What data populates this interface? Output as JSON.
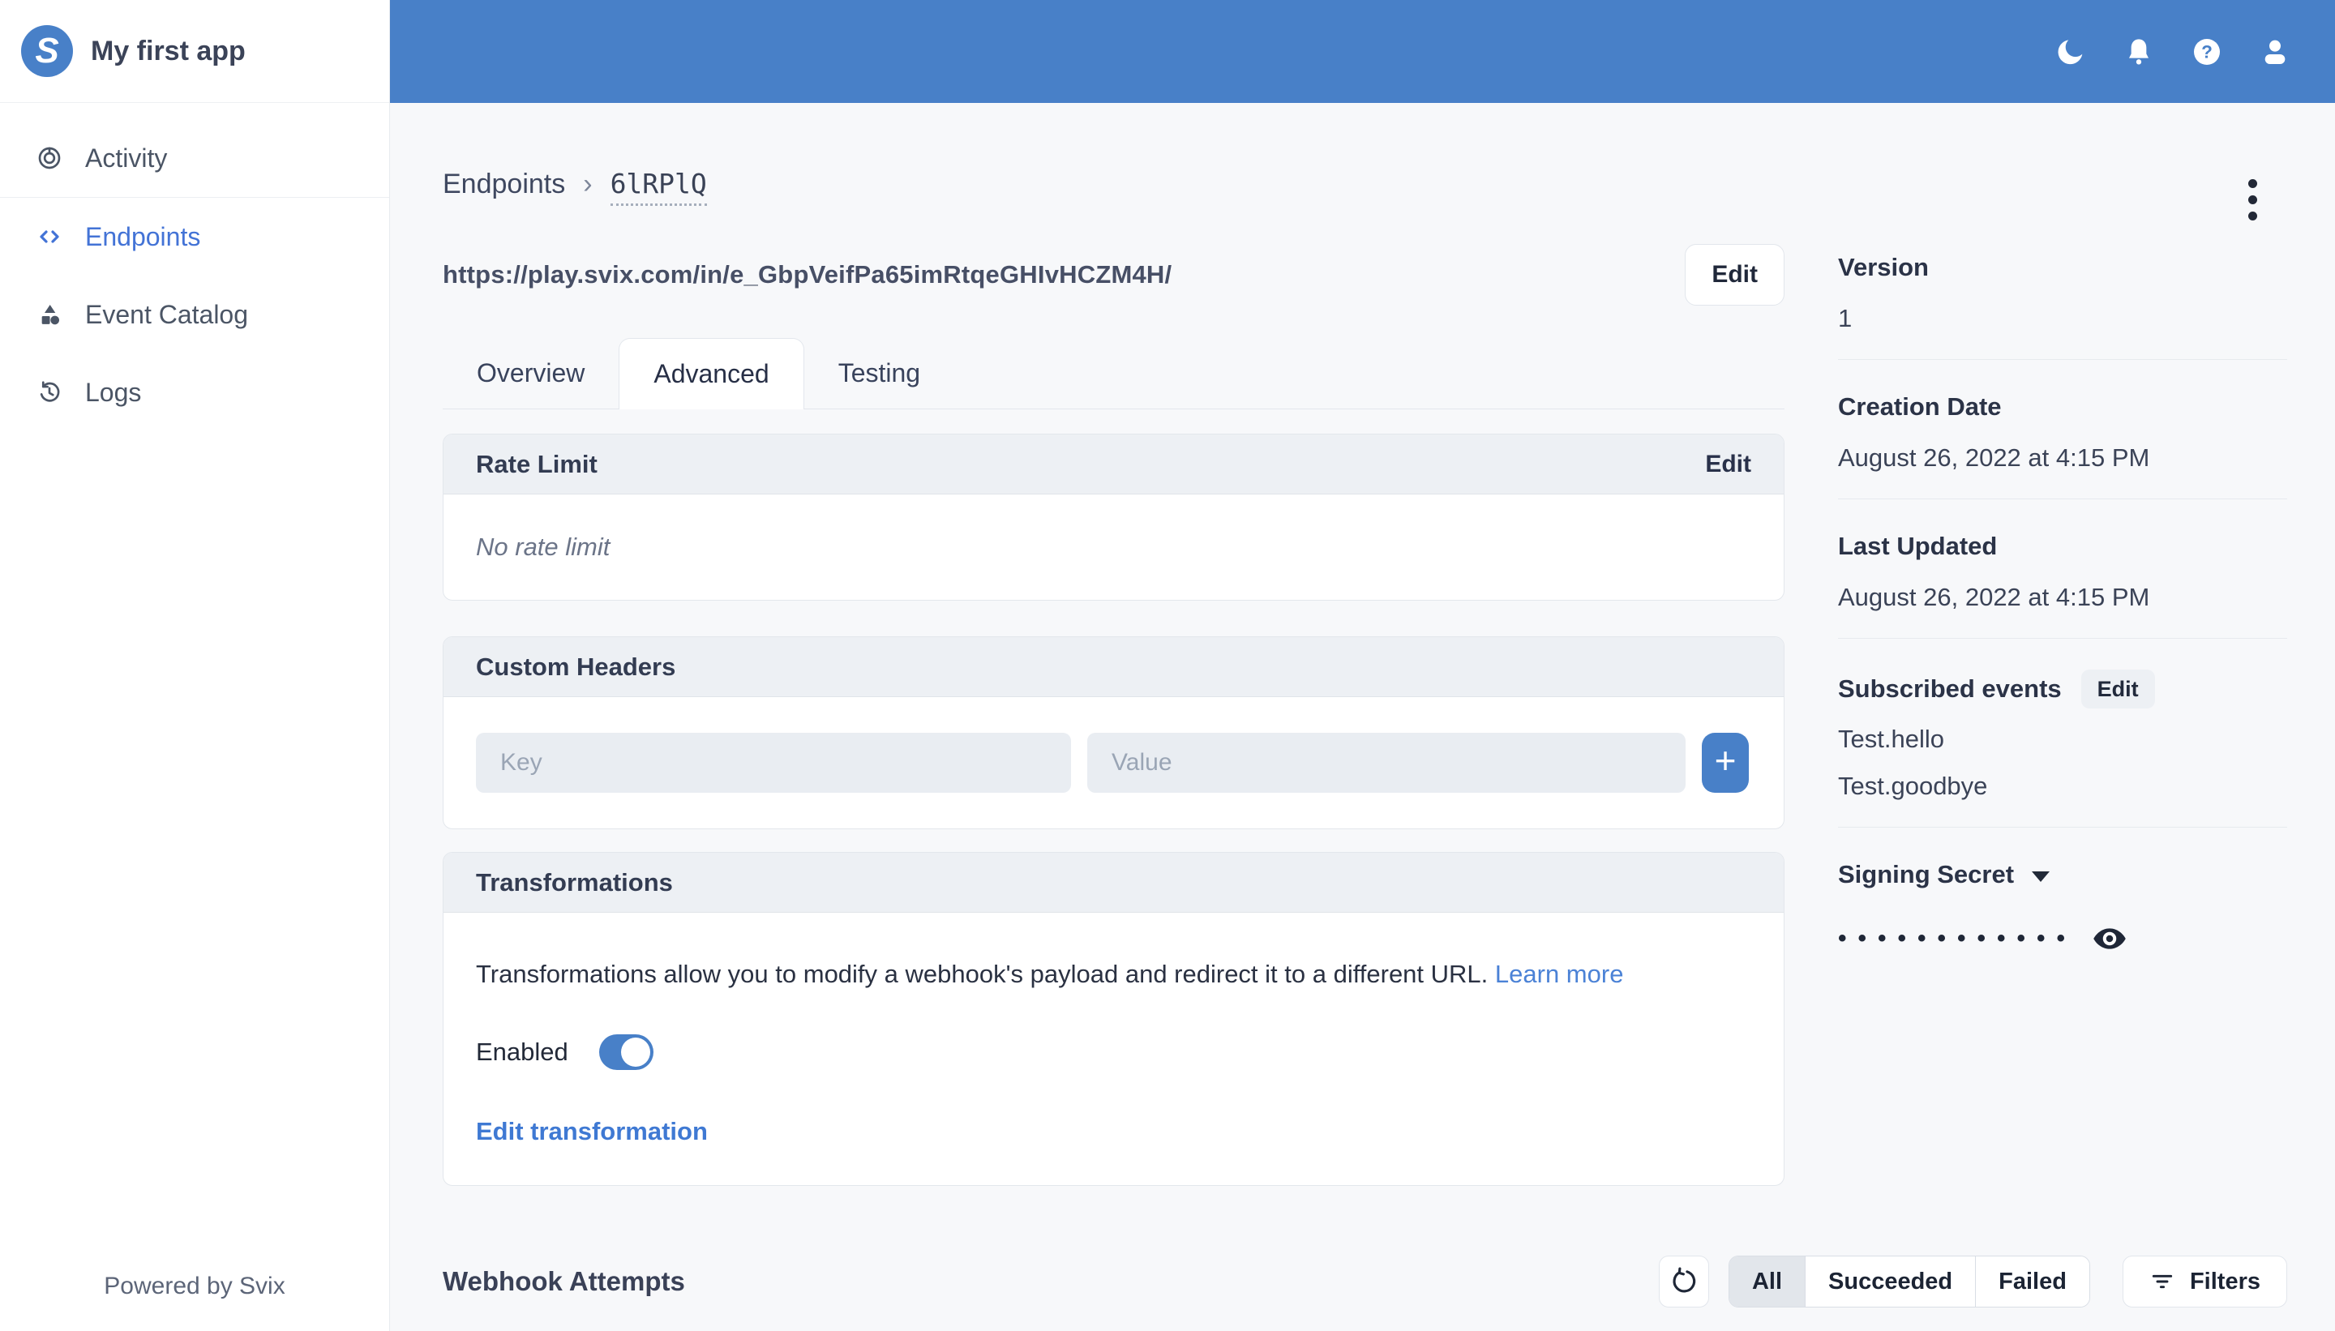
{
  "colors": {
    "topbar_blue": "#4880c8",
    "accent_blue": "#4880c8",
    "sidebar_active_blue": "#4373d6",
    "link_blue": "#4b82d6",
    "card_header_bg": "#edf0f4",
    "page_bg": "#f7f8fa"
  },
  "app": {
    "title": "My first app",
    "logo_letter": "S",
    "powered_by": "Powered by Svix"
  },
  "sidebar": {
    "items": [
      {
        "label": "Activity",
        "icon": "activity-icon"
      },
      {
        "label": "Endpoints",
        "icon": "code-brackets-icon",
        "active": true
      },
      {
        "label": "Event Catalog",
        "icon": "shapes-icon"
      },
      {
        "label": "Logs",
        "icon": "clock-history-icon"
      }
    ]
  },
  "topbar": {
    "icons": [
      "dark-mode-moon-icon",
      "notifications-bell-icon",
      "help-icon",
      "account-icon"
    ],
    "help_glyph": "?"
  },
  "breadcrumb": {
    "root": "Endpoints",
    "separator": "›",
    "current": "6lRPlQ"
  },
  "endpoint": {
    "url": "https://play.svix.com/in/e_GbpVeifPa65imRtqeGHIvHCZM4H/",
    "edit_label": "Edit"
  },
  "tabs": {
    "items": [
      {
        "label": "Overview"
      },
      {
        "label": "Advanced",
        "active": true
      },
      {
        "label": "Testing"
      }
    ]
  },
  "rate_limit_card": {
    "title": "Rate Limit",
    "edit_label": "Edit",
    "empty_text": "No rate limit"
  },
  "custom_headers_card": {
    "title": "Custom Headers",
    "key_placeholder": "Key",
    "value_placeholder": "Value",
    "add_label": "+"
  },
  "transformations_card": {
    "title": "Transformations",
    "description": "Transformations allow you to modify a webhook's payload and redirect it to a different URL.",
    "learn_more_label": "Learn more",
    "enabled_label": "Enabled",
    "enabled": true,
    "edit_link_label": "Edit transformation"
  },
  "details": {
    "version": {
      "label": "Version",
      "value": "1"
    },
    "creation_date": {
      "label": "Creation Date",
      "value": "August 26, 2022 at 4:15 PM"
    },
    "last_updated": {
      "label": "Last Updated",
      "value": "August 26, 2022 at 4:15 PM"
    },
    "subscribed_events": {
      "label": "Subscribed events",
      "edit_label": "Edit",
      "events": [
        "Test.hello",
        "Test.goodbye"
      ]
    },
    "signing_secret": {
      "label": "Signing Secret",
      "masked_value": "••••••••••••"
    }
  },
  "attempts": {
    "title": "Webhook Attempts",
    "segments": {
      "all": "All",
      "succeeded": "Succeeded",
      "failed": "Failed"
    },
    "filters_label": "Filters"
  }
}
